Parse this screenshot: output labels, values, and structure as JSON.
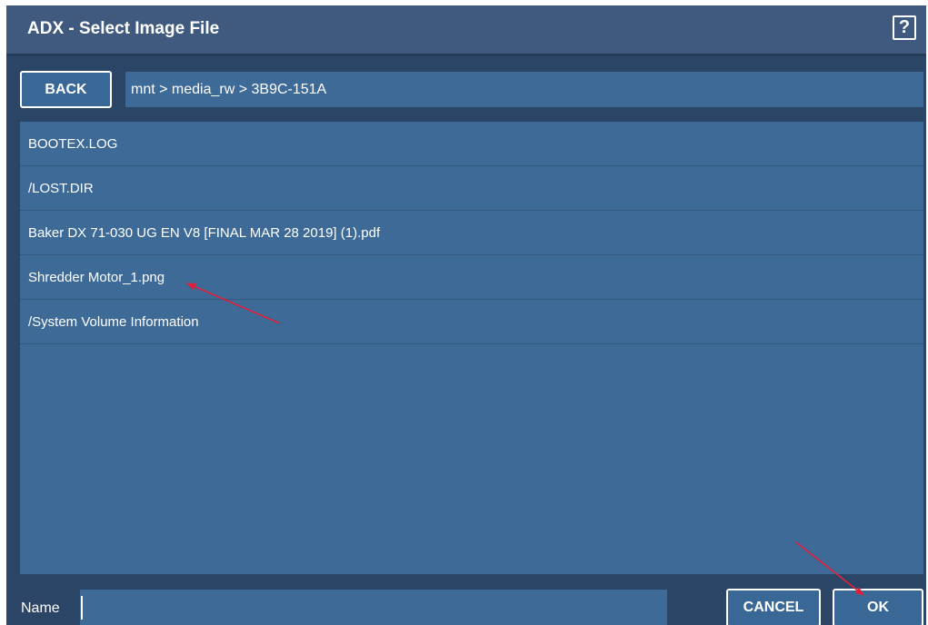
{
  "window": {
    "title": "ADX - Select Image File",
    "help_label": "?"
  },
  "navigation": {
    "back_label": "BACK",
    "path": "mnt > media_rw > 3B9C-151A"
  },
  "files": [
    {
      "name": "BOOTEX.LOG"
    },
    {
      "name": "/LOST.DIR"
    },
    {
      "name": "Baker DX 71-030 UG EN V8 [FINAL MAR 28 2019] (1).pdf"
    },
    {
      "name": "Shredder Motor_1.png"
    },
    {
      "name": "/System Volume Information"
    }
  ],
  "footer": {
    "name_label": "Name",
    "name_value": "",
    "cancel_label": "CANCEL",
    "ok_label": "OK"
  },
  "colors": {
    "dialog_background": "#2b4566",
    "panel_background": "#3e6a98",
    "annotation_arrow": "#e0203a"
  }
}
